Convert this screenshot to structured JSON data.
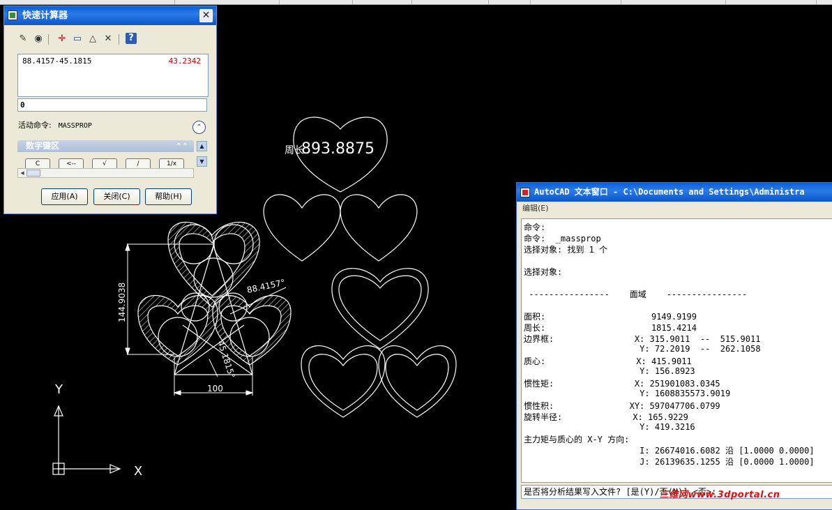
{
  "quickcalc": {
    "title": "快速计算器",
    "close_glyph": "✕",
    "history": {
      "expression": "88.4157-45.1815",
      "result": "43.2342"
    },
    "input_value": "0",
    "active_command_label": "活动命令:",
    "active_command": "MASSPROP",
    "expand_glyph": "⌃",
    "keypad": {
      "header": "数字键区",
      "collapse_glyph": "⌃⌃",
      "keys": [
        "C",
        "<--",
        "√",
        "/",
        "1/x"
      ]
    },
    "buttons": {
      "apply": "应用(A)",
      "close": "关闭(C)",
      "help": "帮助(H)"
    },
    "toolbar": [
      {
        "name": "clear-icon",
        "glyph": "✎"
      },
      {
        "name": "clear-history-icon",
        "glyph": "◉"
      },
      {
        "name": "get-coordinates-icon",
        "glyph": "✛"
      },
      {
        "name": "distance-icon",
        "glyph": "▭"
      },
      {
        "name": "angle-icon",
        "glyph": "△"
      },
      {
        "name": "intersection-icon",
        "glyph": "✕"
      },
      {
        "name": "help-icon",
        "glyph": "?"
      }
    ]
  },
  "drawing": {
    "dim_text_large": "893.8875",
    "dim_text_large_prefix": "周长",
    "dim_vertical": "144.9038",
    "dim_angle_1": "88.4157°",
    "dim_angle_2": "45.1815°",
    "dim_horizontal": "100",
    "ucs_x": "X",
    "ucs_y": "Y"
  },
  "textwindow": {
    "title": "AutoCAD 文本窗口 - C:\\Documents and Settings\\Administra",
    "menu": "编辑(E)",
    "lines": [
      "命令:",
      "命令:  _massprop",
      "选择对象: 找到 1 个",
      "",
      "选择对象:",
      "",
      " ----------------    面域    ----------------",
      "",
      "面积:                     9149.9199",
      "周长:                     1815.4214",
      "边界框:                X: 315.9011  --  515.9011",
      "                       Y: 72.2019  --  262.1058",
      "质心:                  X: 415.9011",
      "                       Y: 156.8923",
      "惯性矩:                X: 251901083.0345",
      "                       Y: 1608835573.9019",
      "惯性积:               XY: 597047706.0799",
      "旋转半径:              X: 165.9229",
      "                       Y: 419.3216",
      "主力矩与质心的 X-Y 方向:",
      "                       I: 26674016.6082 沿 [1.0000 0.0000]",
      "                       J: 26139635.1255 沿 [0.0000 1.0000]"
    ],
    "prompt": "是否将分析结果写入文件? [是(Y)/否(N)] <否>:"
  },
  "watermark": "三维网www.3dportal.cn",
  "colors": {
    "titlebar": "#0a5fd8",
    "drawing_bg": "#000000",
    "drawing_lines": "#ffffff",
    "result_red": "#c00000",
    "watermark": "#e01010"
  }
}
